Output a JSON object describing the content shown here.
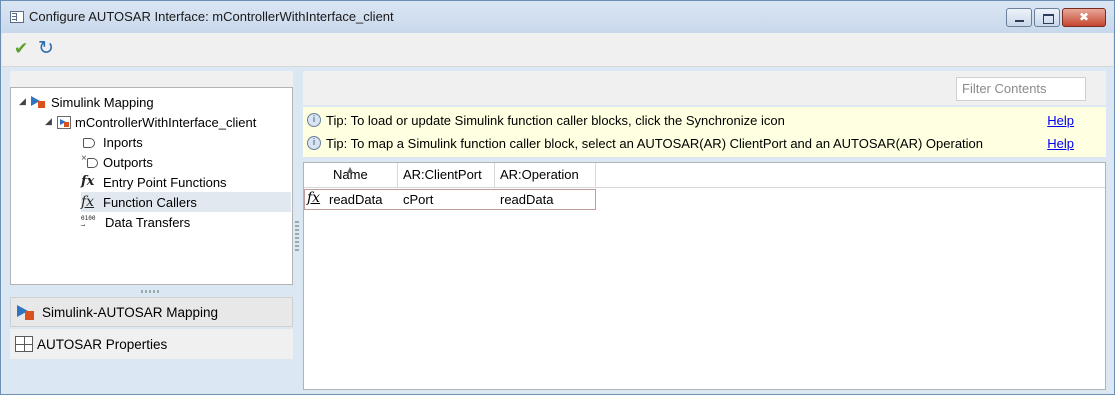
{
  "window": {
    "title": "Configure AUTOSAR Interface: mControllerWithInterface_client"
  },
  "toolbar": {
    "apply_icon": "check-icon",
    "sync_icon": "synchronize-icon"
  },
  "tree": {
    "root_label": "Simulink Mapping",
    "model_label": "mControllerWithInterface_client",
    "items": [
      {
        "label": "Inports",
        "icon": "inport-icon"
      },
      {
        "label": "Outports",
        "icon": "outport-icon"
      },
      {
        "label": "Entry Point Functions",
        "icon": "fx-icon"
      },
      {
        "label": "Function Callers",
        "icon": "function-caller-icon",
        "selected": true
      },
      {
        "label": "Data Transfers",
        "icon": "data-transfer-icon"
      }
    ]
  },
  "nav": {
    "mapping_label": "Simulink-AUTOSAR Mapping",
    "properties_label": "AUTOSAR Properties"
  },
  "filter": {
    "placeholder": "Filter Contents"
  },
  "tips": [
    {
      "text": "Tip: To load or update Simulink function caller blocks, click the Synchronize icon",
      "link": "Help"
    },
    {
      "text": "Tip: To map a Simulink function caller block, select an AUTOSAR(AR) ClientPort and an AUTOSAR(AR) Operation",
      "link": "Help"
    }
  ],
  "table": {
    "columns": [
      "Name",
      "AR:ClientPort",
      "AR:Operation"
    ],
    "rows": [
      {
        "name": "readData",
        "client_port": "cPort",
        "operation": "readData"
      }
    ]
  },
  "colors": {
    "tip_background": "#ffffe1",
    "link": "#0000ee",
    "selected_row_border": "#c29b9b"
  }
}
